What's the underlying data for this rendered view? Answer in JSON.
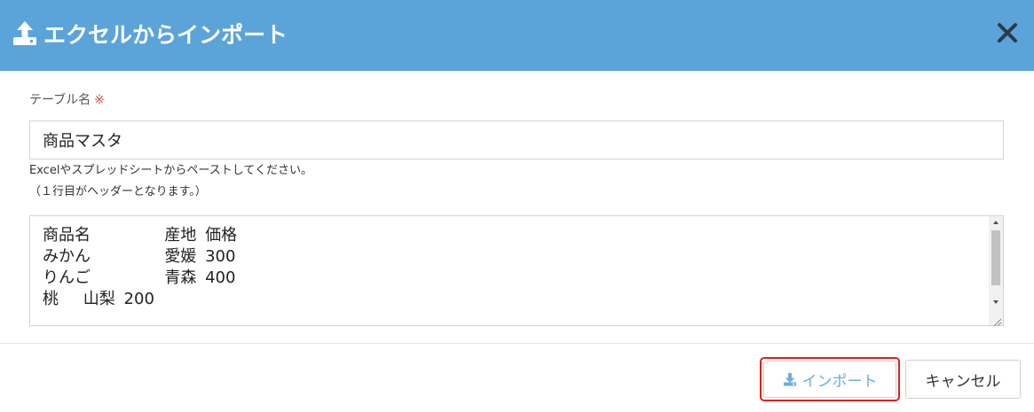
{
  "dialog": {
    "title": "エクセルからインポート",
    "header_icon": "upload-icon",
    "close_icon": "close-icon",
    "header_color": "#5ba4da"
  },
  "form": {
    "table_name_label": "テーブル名",
    "required_mark": "※",
    "table_name_value": "商品マスタ",
    "help_text_line1": "Excelやスプレッドシートからペーストしてください。",
    "help_text_line2": "（１行目がヘッダーとなります。）",
    "paste_content": "商品名\t\t産地\t価格\nみかん\t\t愛媛\t300\nりんご\t\t青森\t400\n桃\t山梨\t200"
  },
  "footer": {
    "import_label": "インポート",
    "import_icon": "download-icon",
    "cancel_label": "キャンセル",
    "highlight_color": "#e02020",
    "import_text_color": "#6aaee0"
  }
}
